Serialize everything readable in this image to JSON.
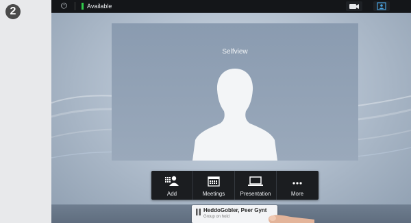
{
  "step": {
    "number": "2"
  },
  "topbar": {
    "status_label": "Available",
    "status_color": "#2fcc4a"
  },
  "selfview": {
    "label": "Selfview"
  },
  "toolbar": {
    "items": [
      {
        "label": "Add",
        "icon": "add-participant-icon"
      },
      {
        "label": "Meetings",
        "icon": "calendar-icon"
      },
      {
        "label": "Presentation",
        "icon": "laptop-icon"
      },
      {
        "label": "More",
        "icon": "more-icon"
      }
    ]
  },
  "call": {
    "name": "HeddoGobler, Peer Gynt",
    "status": "Group on hold",
    "icon": "pause-icon"
  }
}
